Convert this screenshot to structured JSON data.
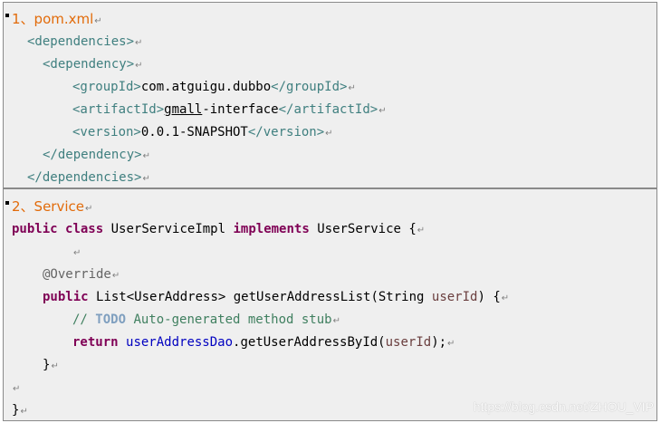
{
  "section1": {
    "title": "1、pom.xml",
    "lines": {
      "l1": "<dependencies>",
      "l2": "<dependency>",
      "l3_open": "<groupId>",
      "l3_val": "com.atguigu.dubbo",
      "l3_close": "</groupId>",
      "l4_open": "<artifactId>",
      "l4_val_u": "gmall",
      "l4_val_rest": "-interface",
      "l4_close": "</artifactId>",
      "l5_open": "<version>",
      "l5_val": "0.0.1-SNAPSHOT",
      "l5_close": "</version>",
      "l6": "</dependency>",
      "l7": "</dependencies>"
    }
  },
  "section2": {
    "title": "2、Service",
    "code": {
      "kw_public": "public",
      "kw_class": "class",
      "class_name": "UserServiceImpl",
      "kw_implements": "implements",
      "iface_name": "UserService {",
      "annotation": "@Override",
      "kw_public2": "public",
      "method_sig_1": "List<UserAddress> getUserAddressList(String ",
      "param": "userId",
      "method_sig_2": ") {",
      "comment_prefix": "// ",
      "todo": "TODO",
      "comment_rest": " Auto-generated method stub",
      "kw_return": "return",
      "field": "userAddressDao",
      "call": ".getUserAddressById(",
      "arg": "userId",
      "call_end": ");",
      "close_method": "}",
      "close_class": "}"
    }
  },
  "para_mark": "↵",
  "watermark": "https://blog.csdn.net/ZHOU_VIP"
}
